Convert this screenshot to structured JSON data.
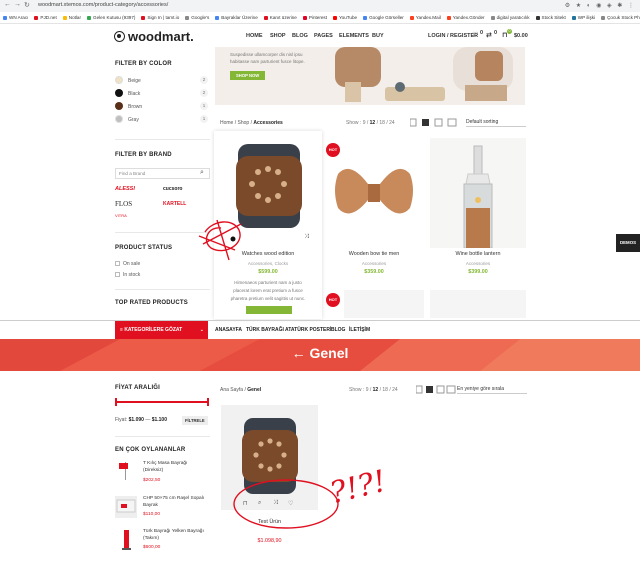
{
  "browser": {
    "url": "woodmart.xtemos.com/product-category/accessories/",
    "bookmarks": [
      "WN Aracı",
      "PJD.net",
      "Notlar",
      "Gelen Kutusu (9397)",
      "Sign In | tamt.io",
      "Google's",
      "Bayraklar Üzerine",
      "Kanıt üzerine",
      "Pinterest",
      "YouTube",
      "Google Görseller",
      "Yandex.Mail",
      "Yandex.Gönder",
      "digital yaratıcılık",
      "Stock Sitekt",
      "WP ilişki",
      "Çocuk Stock Photo"
    ],
    "colors": {
      "chrome_bg": "#f1f3f4"
    }
  },
  "woodmart": {
    "logo": "woodmart.",
    "menu": [
      "HOME",
      "SHOP",
      "BLOG",
      "PAGES",
      "ELEMENTS",
      "BUY"
    ],
    "login": "LOGIN / REGISTER",
    "cart_total": "$0.00",
    "wishlist_count": "0",
    "compare_count": "0",
    "cart_count": "0",
    "banner": {
      "text": "Suspedisse ullamcorper dis nisl ipsu habitasse nam parturient fusce litope.",
      "button": "SHOP NOW"
    },
    "filter_color": {
      "title": "FILTER BY COLOR",
      "items": [
        {
          "name": "Beige",
          "count": "2",
          "color": "#f0e2c4"
        },
        {
          "name": "Black",
          "count": "2",
          "color": "#111111"
        },
        {
          "name": "Brown",
          "count": "1",
          "color": "#5a2f18"
        },
        {
          "name": "Gray",
          "count": "1",
          "color": "#bfbfbf"
        }
      ]
    },
    "filter_brand": {
      "title": "FILTER BY BRAND",
      "placeholder": "Find a Brand",
      "brands": [
        "ALESSI",
        "cucsoro",
        "FLOS",
        "KARTELL",
        "VITRA"
      ]
    },
    "product_status": {
      "title": "PRODUCT STATUS",
      "items": [
        "On sale",
        "In stock"
      ]
    },
    "top_rated": {
      "title": "TOP RATED PRODUCTS"
    },
    "breadcrumb": {
      "home": "Home",
      "shop": "Shop",
      "current": "Accessories"
    },
    "show": {
      "label": "Show :",
      "options": [
        "9",
        "12",
        "18",
        "24"
      ],
      "active": "12"
    },
    "sort": "Default sorting",
    "products": [
      {
        "name": "Watches wood edition",
        "category": "Accessories, Clocks",
        "price": "$599.00",
        "desc": "Himenaeos parturient nam a justo placerat lorem erat pretium a fusce pharetra pretium velit sagittis ut nunc.",
        "hot": false
      },
      {
        "name": "Wooden bow tie men",
        "category": "Accessories",
        "price": "$359.00",
        "hot": true
      },
      {
        "name": "Wine bottle lantern",
        "category": "Accessories",
        "price": "$399.00",
        "hot": false
      }
    ],
    "hot_label": "HOT",
    "demos": "DEMOS"
  },
  "turk": {
    "category_button": "KATEGORİLERE GÖZAT",
    "menu": [
      "ANASAYFA",
      "TÜRK BAYRAĞI",
      "ATATÜRK POSTERİ",
      "BLOG",
      "İLETİŞİM"
    ],
    "hero_title": "← Genel",
    "price_filter": {
      "title": "FİYAT ARALIĞI",
      "label": "Fiyat:",
      "min": "$1.090",
      "max": "$1.100",
      "button": "FİLTRELE"
    },
    "bestsellers": {
      "title": "EN ÇOK OYLANANLAR",
      "items": [
        {
          "name": "T Kılıç Masa Bayrağı (Direksiz)",
          "price": "$202,50"
        },
        {
          "name": "CHP 50×75 cm Raşel Sopalı Bayrak",
          "price": "$110,00"
        },
        {
          "name": "Türk Bayrağı Yelken Bayrağı (Takım)",
          "price": "$600,00"
        }
      ]
    },
    "breadcrumb": {
      "home": "Ana Sayfa",
      "current": "Genel"
    },
    "show": {
      "label": "Show :",
      "options": [
        "9",
        "12",
        "18",
        "24"
      ],
      "active": "12"
    },
    "sort": "En yeniye göre sırala",
    "product": {
      "name": "Test Ürün",
      "price": "$1.098,90"
    },
    "annotation": "?!?!",
    "colors": {
      "accent": "#e01020",
      "hero": "#e8473a"
    }
  }
}
